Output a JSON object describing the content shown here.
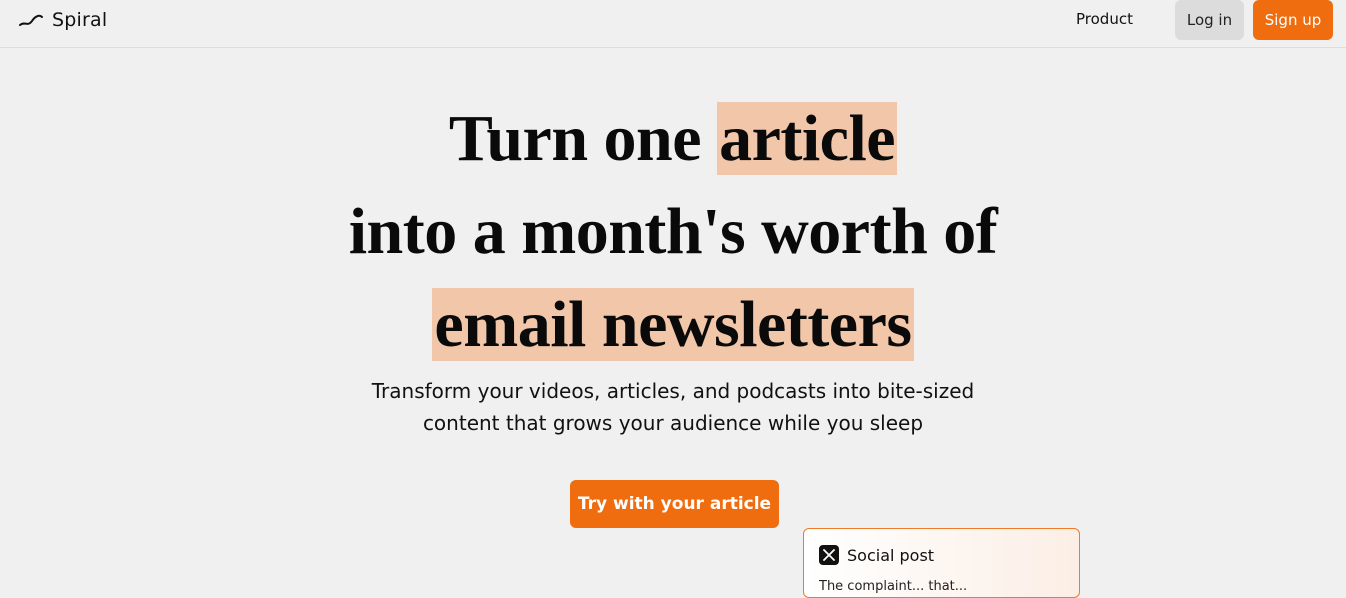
{
  "nav": {
    "logo_text": "Spiral",
    "links": [
      "Product"
    ],
    "login_label": "Log in",
    "signup_label": "Sign up"
  },
  "hero": {
    "line1_plain": "Turn one ",
    "line1_highlight": "article",
    "line2": "into a month's worth of",
    "line3_highlight": "email newsletters",
    "subtitle_line1": "Transform your videos, articles, and podcasts into bite-sized",
    "subtitle_line2": "content that grows your audience while you sleep",
    "cta_label": "Try with your article"
  },
  "card": {
    "icon": "x-logo-icon",
    "title": "Social post",
    "body_preview": "The complaint... that..."
  },
  "colors": {
    "accent": "#ef6c0f",
    "highlight": "#f2c6a9",
    "background": "#f0f0f0"
  }
}
